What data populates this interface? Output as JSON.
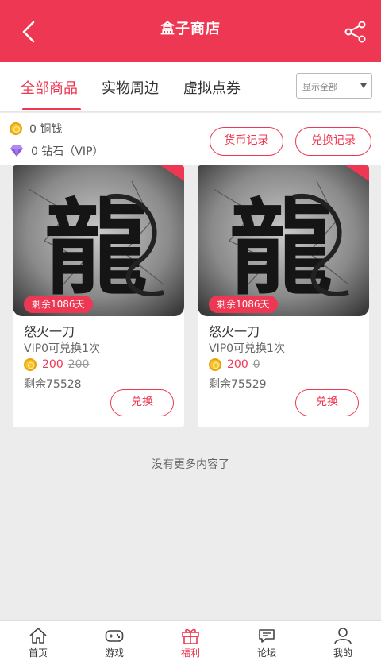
{
  "header": {
    "title": "盒子商店"
  },
  "tabs": [
    {
      "label": "全部商品",
      "active": true
    },
    {
      "label": "实物周边",
      "active": false
    },
    {
      "label": "虚拟点券",
      "active": false
    }
  ],
  "filter": {
    "selected": "显示全部"
  },
  "balance": {
    "copper": "0 铜钱",
    "diamond": "0 钻石（VIP）",
    "currency_record_label": "货币记录",
    "exchange_record_label": "兑换记录"
  },
  "products": [
    {
      "days_left": "剩余1086天",
      "name": "怒火一刀",
      "limit": "VIP0可兑换1次",
      "price": "200",
      "original_price": "200",
      "stock": "剩余75528",
      "button": "兑换"
    },
    {
      "days_left": "剩余1086天",
      "name": "怒火一刀",
      "limit": "VIP0可兑换1次",
      "price": "200",
      "original_price": "0",
      "stock": "剩余75529",
      "button": "兑换"
    }
  ],
  "footer_text": "没有更多内容了",
  "nav": [
    {
      "label": "首页",
      "icon": "home-icon"
    },
    {
      "label": "游戏",
      "icon": "gamepad-icon"
    },
    {
      "label": "福利",
      "icon": "gift-icon",
      "active": true
    },
    {
      "label": "论坛",
      "icon": "chat-icon"
    },
    {
      "label": "我的",
      "icon": "user-icon"
    }
  ],
  "colors": {
    "accent": "#ee3853",
    "coin": "#f7c32b",
    "diamond": "#8a5bd6"
  }
}
